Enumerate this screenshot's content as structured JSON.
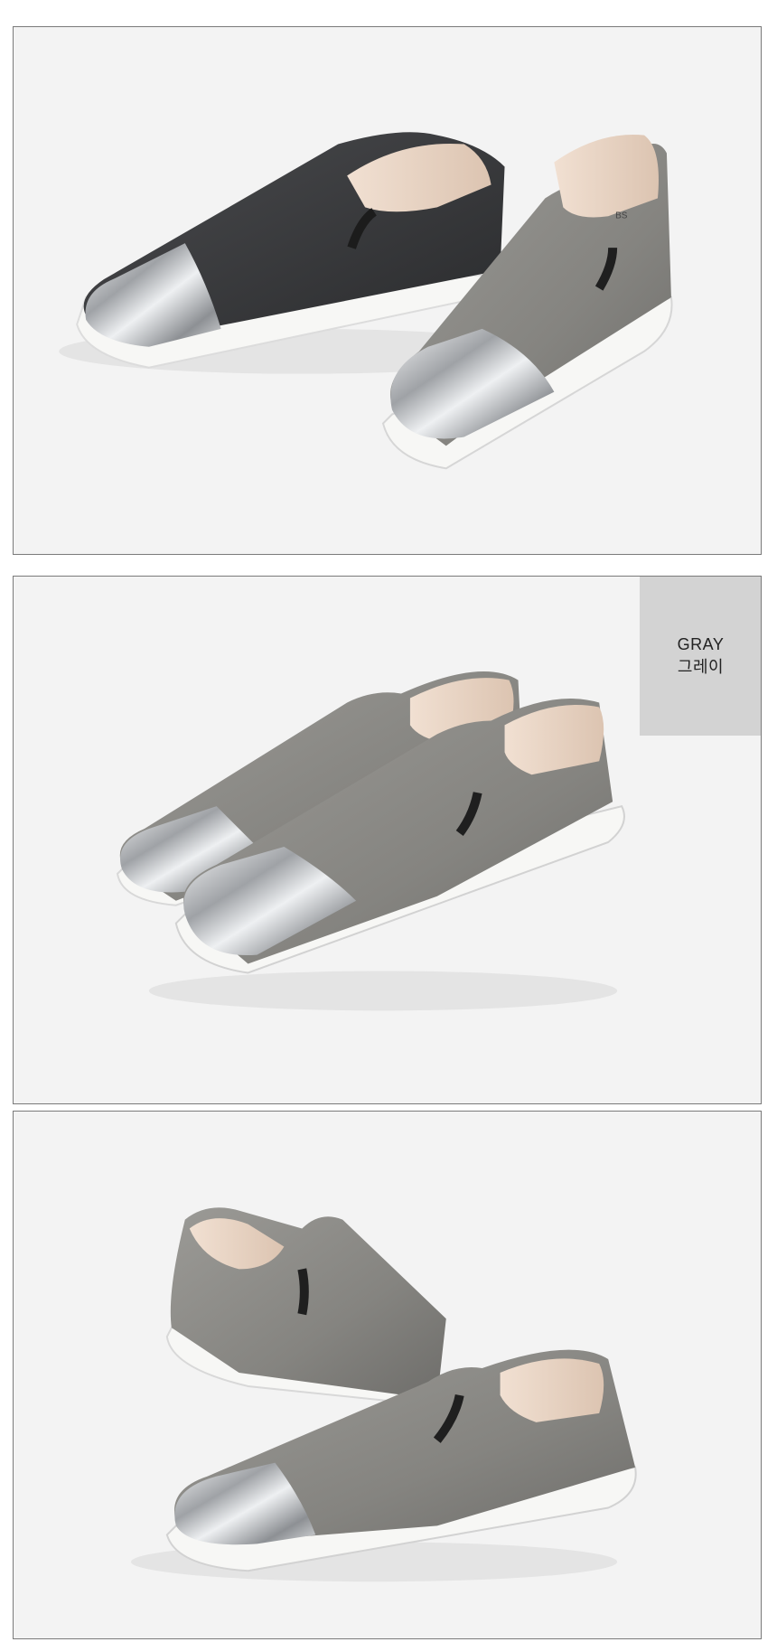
{
  "panels": [
    {
      "id": "black-and-gray-pair",
      "shoes": [
        "black",
        "gray"
      ]
    },
    {
      "id": "gray-pair-front",
      "shoes": [
        "gray",
        "gray"
      ]
    },
    {
      "id": "gray-pair-side",
      "shoes": [
        "gray",
        "gray"
      ]
    }
  ],
  "color_label": {
    "en": "GRAY",
    "ko": "그레이"
  },
  "insole_print": "BS",
  "colors": {
    "gray_upper": "#8a8985",
    "gray_upper_dark": "#6c6b68",
    "black_upper": "#3a3b3d",
    "black_upper_dark": "#222325",
    "silver_cap": "#c9cbcd",
    "sole": "#f7f7f5",
    "insole": "#ead6c6",
    "panel_bg": "#f3f3f3",
    "label_bg": "#d3d3d3"
  }
}
